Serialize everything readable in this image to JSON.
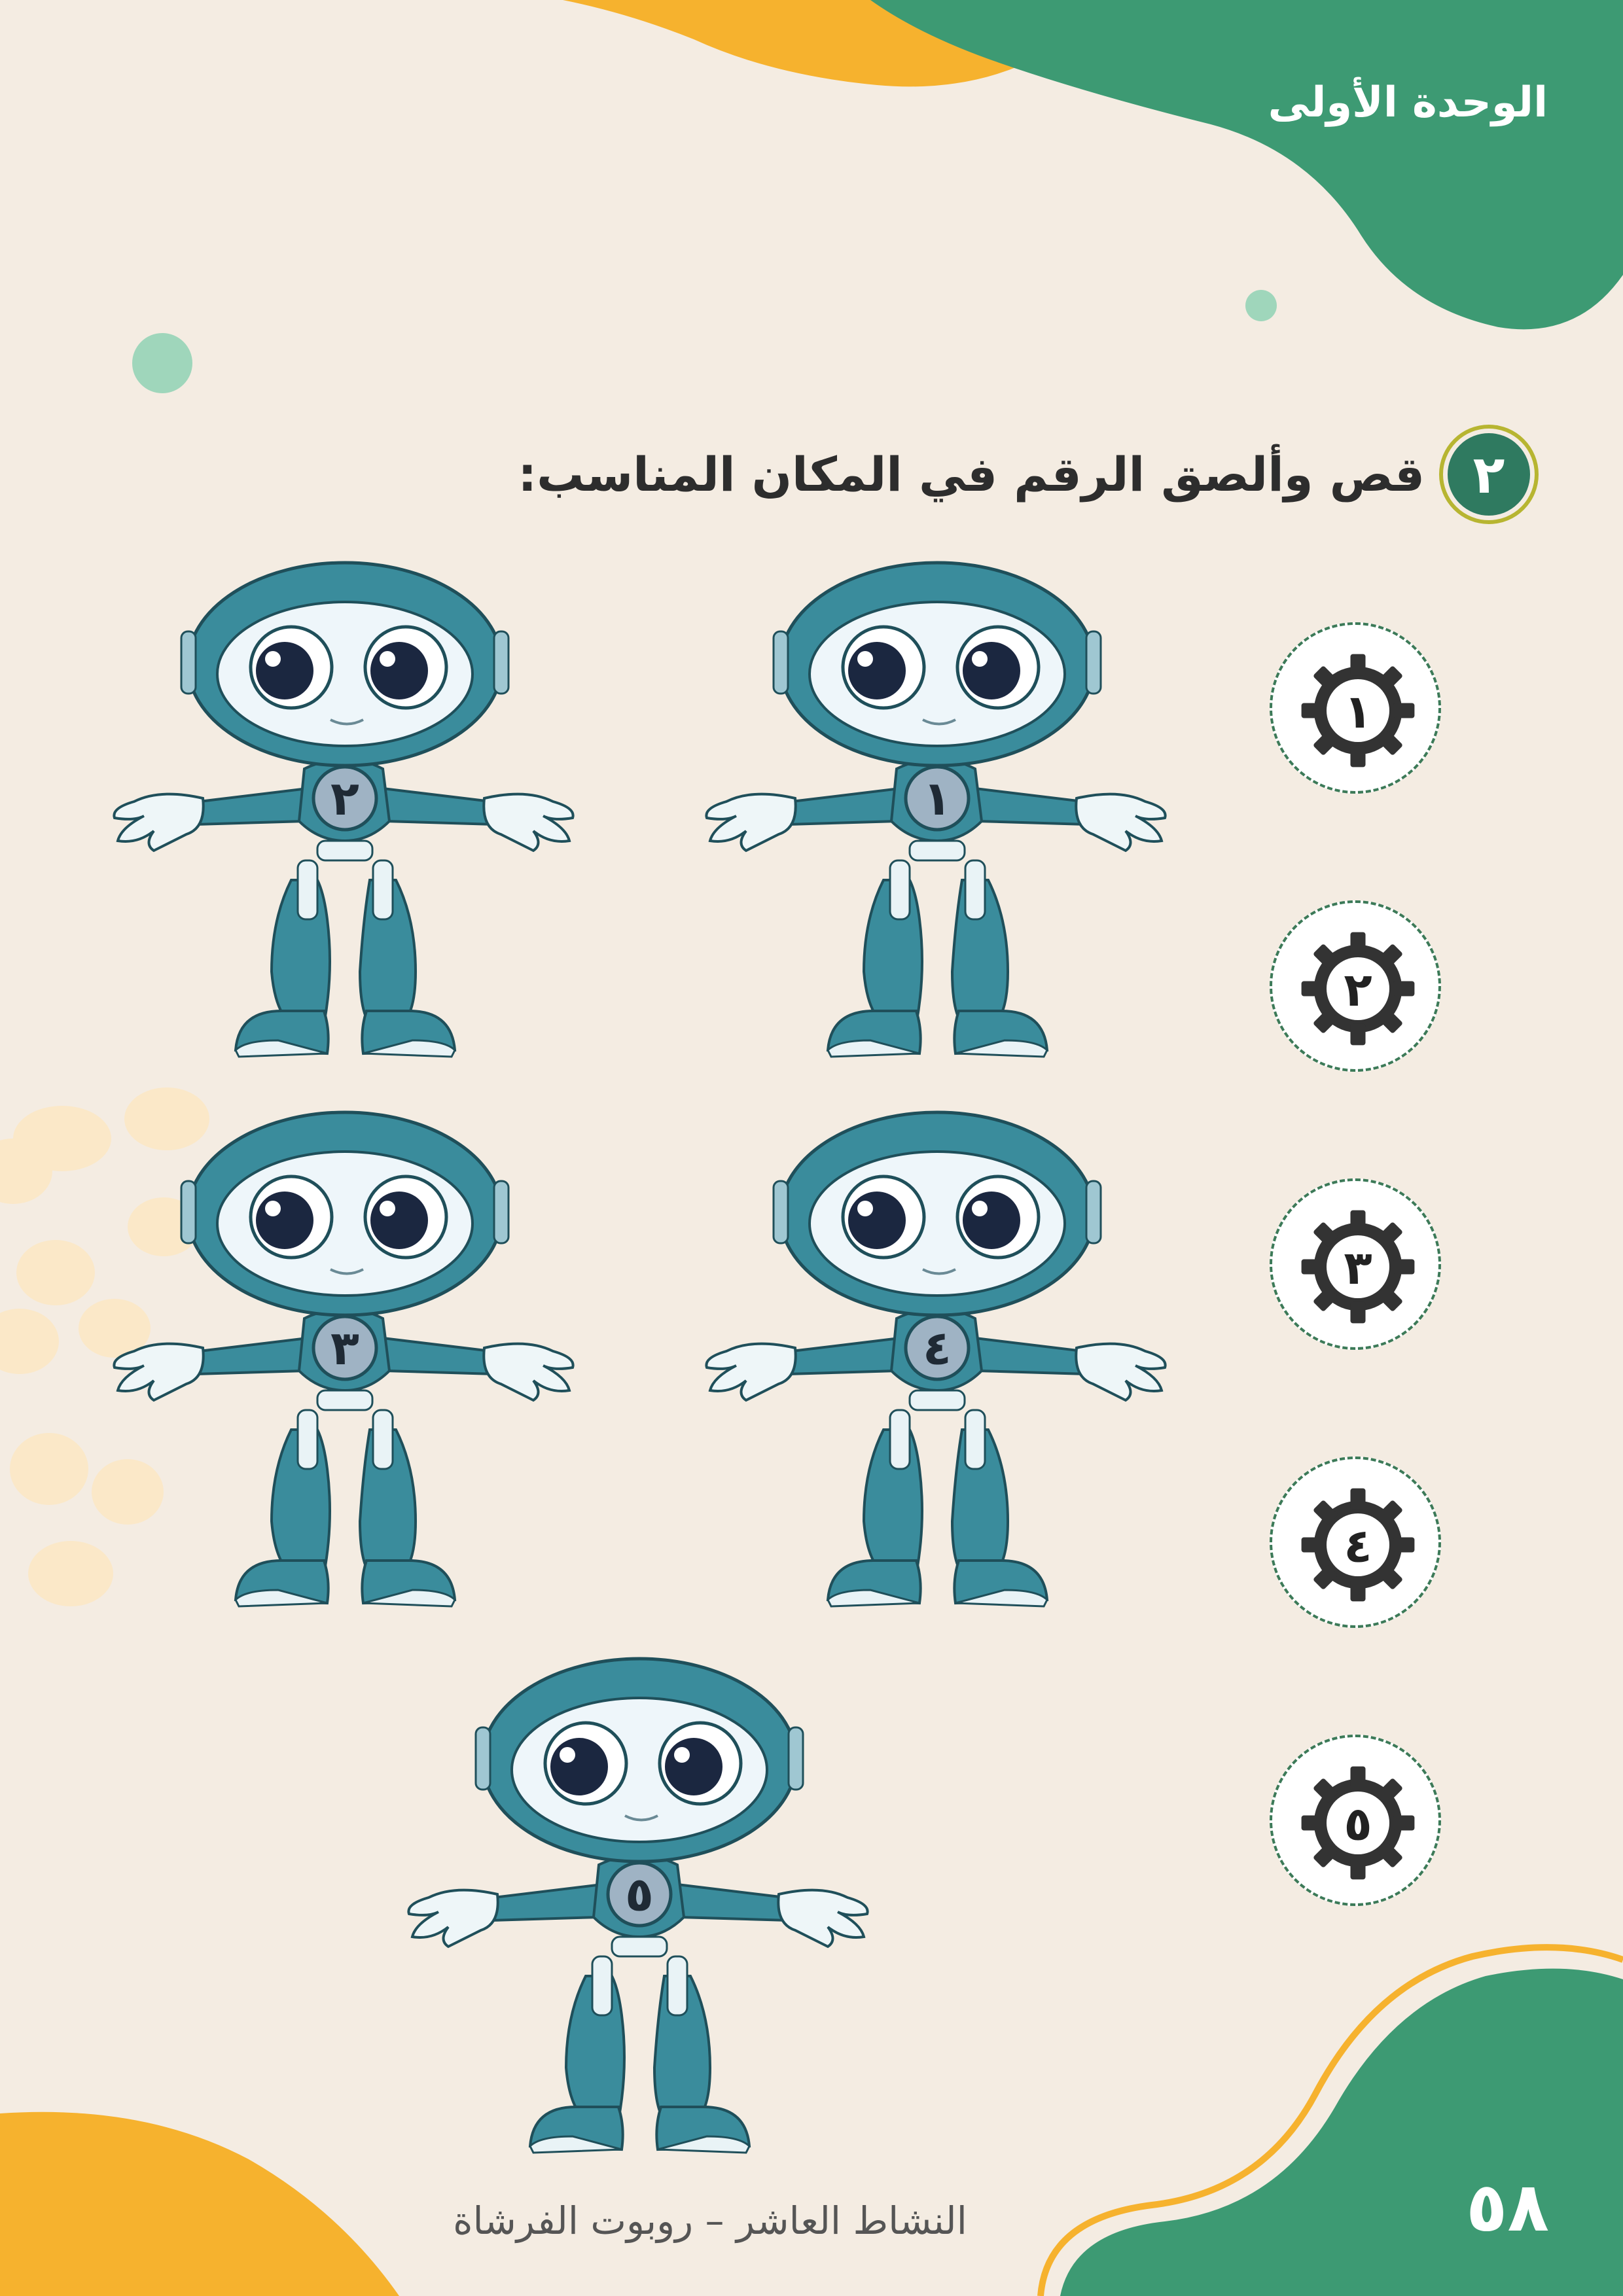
{
  "unit_title": "الوحدة الأولى",
  "activity": {
    "number": "٢",
    "instruction": "قص وألصق الرقم في المكان المناسب:"
  },
  "robots": [
    {
      "number": "١"
    },
    {
      "number": "٢"
    },
    {
      "number": "٤"
    },
    {
      "number": "٣"
    },
    {
      "number": "٥"
    }
  ],
  "stickers": [
    {
      "number": "١"
    },
    {
      "number": "٢"
    },
    {
      "number": "٣"
    },
    {
      "number": "٤"
    },
    {
      "number": "٥"
    }
  ],
  "footer": {
    "activity_title": "النشاط العاشر – روبوت الفرشاة",
    "page_number": "٥٨"
  },
  "colors": {
    "background": "#f4ece2",
    "green": "#3d9a73",
    "orange": "#f6b22e",
    "robot_teal": "#3a8c9c",
    "gear": "#333333"
  }
}
